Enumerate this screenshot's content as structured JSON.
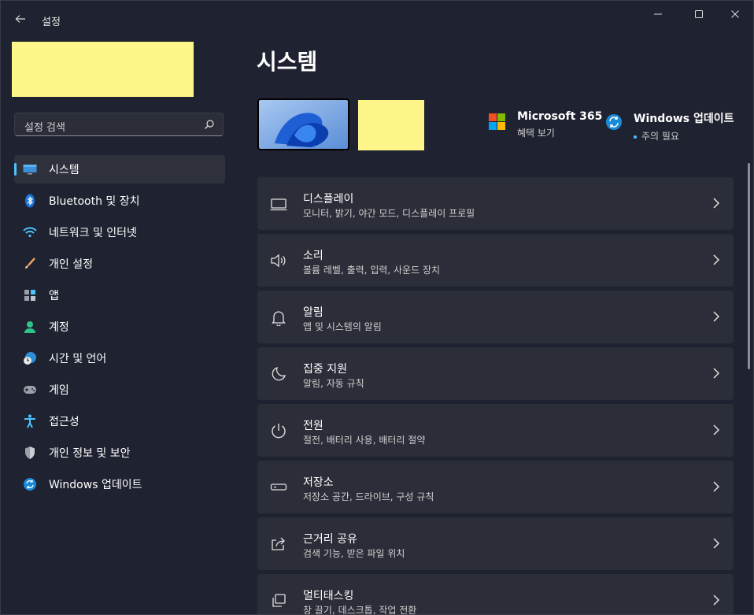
{
  "window": {
    "title": "설정"
  },
  "search": {
    "placeholder": "설정 검색"
  },
  "sidebar": {
    "items": [
      {
        "label": "시스템"
      },
      {
        "label": "Bluetooth 및 장치"
      },
      {
        "label": "네트워크 및 인터넷"
      },
      {
        "label": "개인 설정"
      },
      {
        "label": "앱"
      },
      {
        "label": "계정"
      },
      {
        "label": "시간 및 언어"
      },
      {
        "label": "게임"
      },
      {
        "label": "접근성"
      },
      {
        "label": "개인 정보 및 보안"
      },
      {
        "label": "Windows 업데이트"
      }
    ],
    "active_index": 0
  },
  "main": {
    "title": "시스템",
    "quick": {
      "ms365": {
        "title": "Microsoft 365",
        "sub": "혜택 보기"
      },
      "update": {
        "title": "Windows 업데이트",
        "sub": "주의 필요"
      }
    },
    "cards": [
      {
        "title": "디스플레이",
        "sub": "모니터, 밝기, 야간 모드, 디스플레이 프로필",
        "icon": "monitor-icon"
      },
      {
        "title": "소리",
        "sub": "볼륨 레벨, 출력, 입력, 사운드 장치",
        "icon": "speaker-icon"
      },
      {
        "title": "알림",
        "sub": "앱 및 시스템의 알림",
        "icon": "bell-icon"
      },
      {
        "title": "집중 지원",
        "sub": "알림, 자동 규칙",
        "icon": "moon-icon"
      },
      {
        "title": "전원",
        "sub": "절전, 배터리 사용, 배터리 절약",
        "icon": "power-icon"
      },
      {
        "title": "저장소",
        "sub": "저장소 공간, 드라이브, 구성 규칙",
        "icon": "storage-icon"
      },
      {
        "title": "근거리 공유",
        "sub": "검색 기능, 받은 파일 위치",
        "icon": "share-icon"
      },
      {
        "title": "멀티태스킹",
        "sub": "창 끌기, 데스크톱, 작업 전환",
        "icon": "multitask-icon"
      }
    ]
  },
  "colors": {
    "accent": "#4cc2ff",
    "background": "#1f2230",
    "card": "#2b2e38",
    "redacted": "#fff68a"
  }
}
